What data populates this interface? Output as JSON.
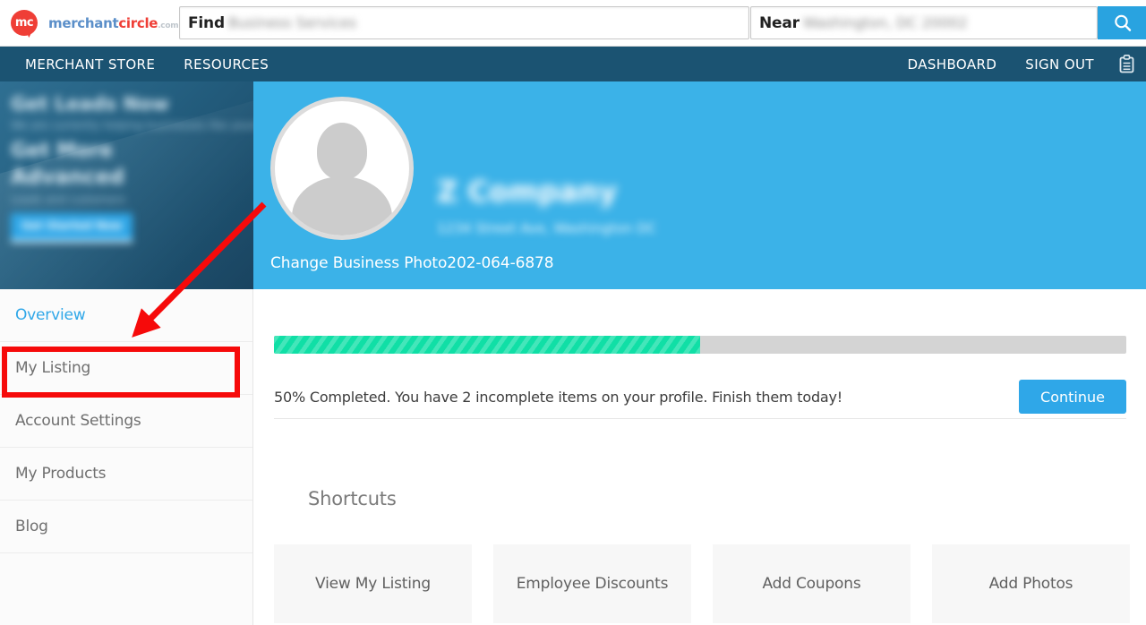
{
  "search": {
    "find_label": "Find",
    "find_value": "Business Services",
    "near_label": "Near",
    "near_value": "Washington, DC 20002",
    "search_icon": "search-icon"
  },
  "logo": {
    "mark_text": "mc",
    "word1": "merchant",
    "word2": "circle",
    "word3": ".com",
    "word4": "®",
    "brand_red": "#ef3e36",
    "brand_blue": "#5b8fc9"
  },
  "nav": {
    "left_items": [
      {
        "label": "MERCHANT STORE"
      },
      {
        "label": "RESOURCES"
      }
    ],
    "right_items": [
      {
        "label": "DASHBOARD"
      },
      {
        "label": "SIGN OUT"
      }
    ],
    "icon": "clipboard-icon",
    "bar_color": "#1b5372"
  },
  "promo": {
    "line1": "Get Leads Now",
    "line2": "We are currently helping businesses like yours",
    "line3": "Get  More",
    "line4": "Advanced",
    "line5": "Leads and customers",
    "cta": "Get Started Now"
  },
  "profile": {
    "avatar_icon": "person-placeholder-icon",
    "business_name": "Z Company",
    "business_address": "1234 Street Ave, Washington DC",
    "change_photo_label": "Change Business Photo",
    "phone": "202-064-6878",
    "header_color": "#3bb2e8"
  },
  "sidebar": {
    "items": [
      {
        "label": "Overview",
        "active": true
      },
      {
        "label": "My Listing",
        "active": false
      },
      {
        "label": "Account Settings",
        "active": false
      },
      {
        "label": "My Products",
        "active": false
      },
      {
        "label": "Blog",
        "active": false
      }
    ]
  },
  "progress": {
    "percent": 50,
    "message": "50% Completed. You have 2 incomplete items on your profile. Finish them today!",
    "continue_label": "Continue",
    "fill_color": "#10dfa6",
    "track_color": "#d4d4d4"
  },
  "shortcuts": {
    "title": "Shortcuts",
    "cards": [
      {
        "label": "View My Listing"
      },
      {
        "label": "Employee Discounts"
      },
      {
        "label": "Add Coupons"
      },
      {
        "label": "Add Photos"
      }
    ]
  },
  "annotations": {
    "highlight_color": "#f60a0a",
    "arrow_from": "295,228",
    "arrow_to": "152,372",
    "box_target": "My Listing"
  }
}
